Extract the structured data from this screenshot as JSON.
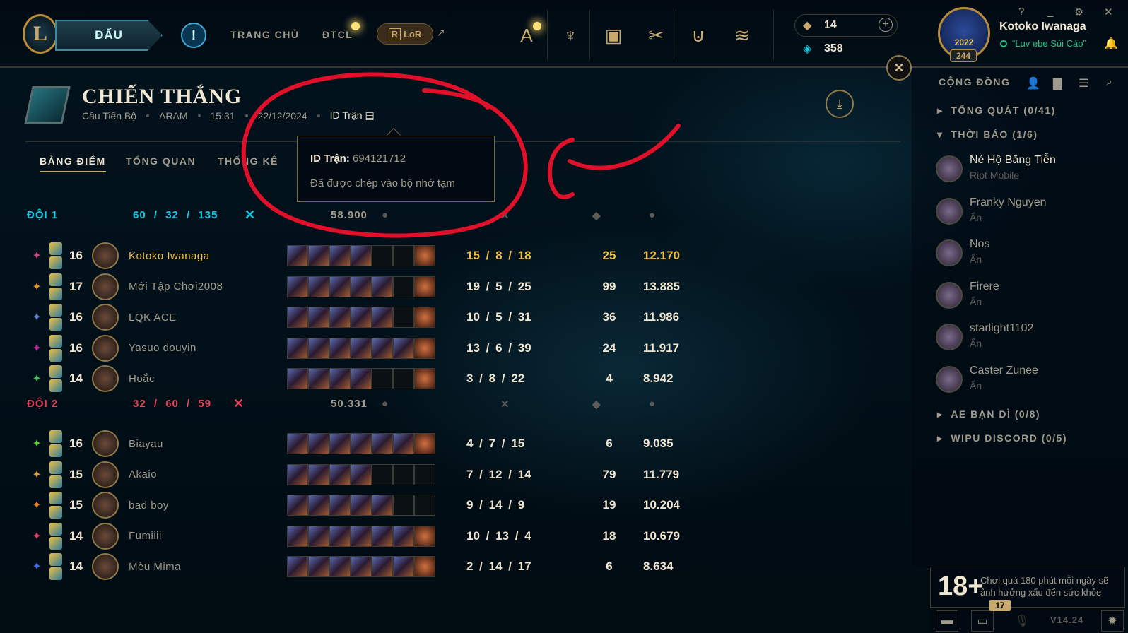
{
  "topbar": {
    "play_label": "ĐẤU",
    "alert_label": "!",
    "nav_home": "TRANG CHỦ",
    "nav_tft": "ĐTCL",
    "lor_label": "LoR",
    "lor_badge": "R",
    "icons": [
      "a-icon",
      "trophy-icon",
      "store-icon",
      "collection-icon",
      "loot-icon",
      "coins-icon"
    ],
    "rp": "14",
    "be": "358",
    "profile_name": "Kotoko Iwanaga",
    "profile_status": "“Luv ebe Sủi Cảo”",
    "profile_level": "244",
    "badge_year": "2022",
    "win_help": "?",
    "win_min": "_",
    "win_settings": "⚙",
    "win_close": "✕"
  },
  "match": {
    "result": "CHIẾN THẮNG",
    "queue": "Cầu Tiến Bộ",
    "mode": "ARAM",
    "duration": "15:31",
    "date": "22/12/2024",
    "id_label": "ID Trận",
    "tabs": [
      "BẢNG ĐIỂM",
      "TỔNG QUAN",
      "THỐNG KÊ"
    ]
  },
  "tooltip": {
    "id_label": "ID Trận:",
    "id_value": "694121712",
    "copied": "Đã được chép vào bộ nhớ tạm"
  },
  "team1": {
    "name": "ĐỘI 1",
    "kills": "60",
    "deaths": "32",
    "assists": "135",
    "gold": "58.900",
    "color": "#0acbe6",
    "players": [
      {
        "level": "16",
        "name": "Kotoko Iwanaga",
        "kda": "15  /  8  / 18",
        "cs": "25",
        "gold": "12.170",
        "items": 4
      },
      {
        "level": "17",
        "name": "Mới Tập Chơi2008",
        "kda": "19  /  5  / 25",
        "cs": "99",
        "gold": "13.885",
        "items": 5
      },
      {
        "level": "16",
        "name": "LQK ACE",
        "kda": "10  /  5  / 31",
        "cs": "36",
        "gold": "11.986",
        "items": 5
      },
      {
        "level": "16",
        "name": "Yasuo douyin",
        "kda": "13  /  6  / 39",
        "cs": "24",
        "gold": "11.917",
        "items": 6
      },
      {
        "level": "14",
        "name": "Hoắc",
        "kda": "3  /  8  / 22",
        "cs": "4",
        "gold": "8.942",
        "items": 4
      }
    ]
  },
  "team2": {
    "name": "ĐỘI 2",
    "kills": "32",
    "deaths": "60",
    "assists": "59",
    "gold": "50.331",
    "color": "#e84057",
    "players": [
      {
        "level": "16",
        "name": "Biayau",
        "kda": "4  /  7  / 15",
        "cs": "6",
        "gold": "9.035",
        "items": 6
      },
      {
        "level": "15",
        "name": "Akaio",
        "kda": "7  / 12  / 14",
        "cs": "79",
        "gold": "11.779",
        "items": 4
      },
      {
        "level": "15",
        "name": "bad boy",
        "kda": "9  / 14  /  9",
        "cs": "19",
        "gold": "10.204",
        "items": 5
      },
      {
        "level": "14",
        "name": "Fumiiii",
        "kda": "10  / 13  /  4",
        "cs": "18",
        "gold": "10.679",
        "items": 6
      },
      {
        "level": "14",
        "name": "Mèu Mima",
        "kda": "2  / 14  / 17",
        "cs": "6",
        "gold": "8.634",
        "items": 6
      }
    ]
  },
  "social": {
    "title": "CỘNG ĐỒNG",
    "groups": [
      {
        "label": "TỔNG QUÁT (0/41)",
        "open": false
      },
      {
        "label": "THỜI BÁO (1/6)",
        "open": true
      },
      {
        "label": "AE BẠN DÌ (0/8)",
        "open": false
      },
      {
        "label": "WIPU DISCORD (0/5)",
        "open": false
      }
    ],
    "friends": [
      {
        "name": "Né Hộ Băng Tiễn",
        "status": "Riot Mobile"
      },
      {
        "name": "Franky Nguyen",
        "status": "Ẩn"
      },
      {
        "name": "Nos",
        "status": "Ẩn"
      },
      {
        "name": "Firere",
        "status": "Ẩn"
      },
      {
        "name": "starlight1102",
        "status": "Ẩn"
      },
      {
        "name": "Caster Zunee",
        "status": "Ẩn"
      }
    ]
  },
  "age_notice": {
    "rating": "18+",
    "text": "Chơi quá 180 phút mỗi ngày sẽ ảnh hưởng xấu đến sức khỏe"
  },
  "bottom": {
    "notif_count": "17",
    "version": "V14.24"
  }
}
